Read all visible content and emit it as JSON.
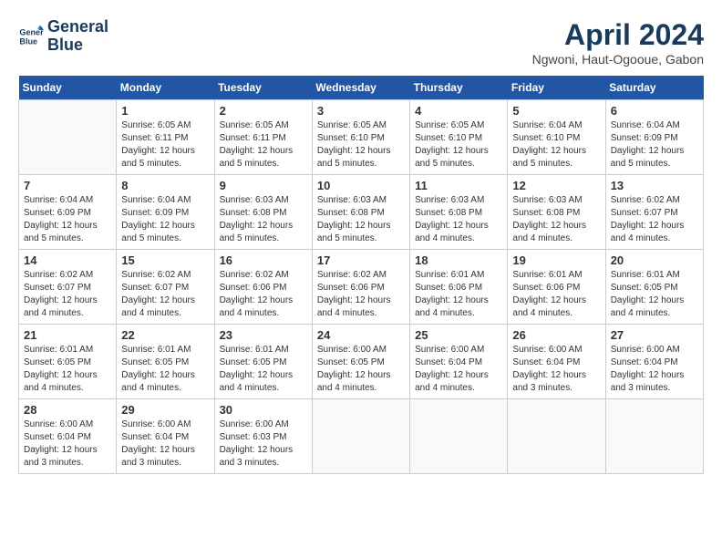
{
  "header": {
    "logo_line1": "General",
    "logo_line2": "Blue",
    "month_year": "April 2024",
    "location": "Ngwoni, Haut-Ogooue, Gabon"
  },
  "days_of_week": [
    "Sunday",
    "Monday",
    "Tuesday",
    "Wednesday",
    "Thursday",
    "Friday",
    "Saturday"
  ],
  "weeks": [
    [
      {
        "day": "",
        "sunrise": "",
        "sunset": "",
        "daylight": ""
      },
      {
        "day": "1",
        "sunrise": "Sunrise: 6:05 AM",
        "sunset": "Sunset: 6:11 PM",
        "daylight": "Daylight: 12 hours and 5 minutes."
      },
      {
        "day": "2",
        "sunrise": "Sunrise: 6:05 AM",
        "sunset": "Sunset: 6:11 PM",
        "daylight": "Daylight: 12 hours and 5 minutes."
      },
      {
        "day": "3",
        "sunrise": "Sunrise: 6:05 AM",
        "sunset": "Sunset: 6:10 PM",
        "daylight": "Daylight: 12 hours and 5 minutes."
      },
      {
        "day": "4",
        "sunrise": "Sunrise: 6:05 AM",
        "sunset": "Sunset: 6:10 PM",
        "daylight": "Daylight: 12 hours and 5 minutes."
      },
      {
        "day": "5",
        "sunrise": "Sunrise: 6:04 AM",
        "sunset": "Sunset: 6:10 PM",
        "daylight": "Daylight: 12 hours and 5 minutes."
      },
      {
        "day": "6",
        "sunrise": "Sunrise: 6:04 AM",
        "sunset": "Sunset: 6:09 PM",
        "daylight": "Daylight: 12 hours and 5 minutes."
      }
    ],
    [
      {
        "day": "7",
        "sunrise": "Sunrise: 6:04 AM",
        "sunset": "Sunset: 6:09 PM",
        "daylight": "Daylight: 12 hours and 5 minutes."
      },
      {
        "day": "8",
        "sunrise": "Sunrise: 6:04 AM",
        "sunset": "Sunset: 6:09 PM",
        "daylight": "Daylight: 12 hours and 5 minutes."
      },
      {
        "day": "9",
        "sunrise": "Sunrise: 6:03 AM",
        "sunset": "Sunset: 6:08 PM",
        "daylight": "Daylight: 12 hours and 5 minutes."
      },
      {
        "day": "10",
        "sunrise": "Sunrise: 6:03 AM",
        "sunset": "Sunset: 6:08 PM",
        "daylight": "Daylight: 12 hours and 5 minutes."
      },
      {
        "day": "11",
        "sunrise": "Sunrise: 6:03 AM",
        "sunset": "Sunset: 6:08 PM",
        "daylight": "Daylight: 12 hours and 4 minutes."
      },
      {
        "day": "12",
        "sunrise": "Sunrise: 6:03 AM",
        "sunset": "Sunset: 6:08 PM",
        "daylight": "Daylight: 12 hours and 4 minutes."
      },
      {
        "day": "13",
        "sunrise": "Sunrise: 6:02 AM",
        "sunset": "Sunset: 6:07 PM",
        "daylight": "Daylight: 12 hours and 4 minutes."
      }
    ],
    [
      {
        "day": "14",
        "sunrise": "Sunrise: 6:02 AM",
        "sunset": "Sunset: 6:07 PM",
        "daylight": "Daylight: 12 hours and 4 minutes."
      },
      {
        "day": "15",
        "sunrise": "Sunrise: 6:02 AM",
        "sunset": "Sunset: 6:07 PM",
        "daylight": "Daylight: 12 hours and 4 minutes."
      },
      {
        "day": "16",
        "sunrise": "Sunrise: 6:02 AM",
        "sunset": "Sunset: 6:06 PM",
        "daylight": "Daylight: 12 hours and 4 minutes."
      },
      {
        "day": "17",
        "sunrise": "Sunrise: 6:02 AM",
        "sunset": "Sunset: 6:06 PM",
        "daylight": "Daylight: 12 hours and 4 minutes."
      },
      {
        "day": "18",
        "sunrise": "Sunrise: 6:01 AM",
        "sunset": "Sunset: 6:06 PM",
        "daylight": "Daylight: 12 hours and 4 minutes."
      },
      {
        "day": "19",
        "sunrise": "Sunrise: 6:01 AM",
        "sunset": "Sunset: 6:06 PM",
        "daylight": "Daylight: 12 hours and 4 minutes."
      },
      {
        "day": "20",
        "sunrise": "Sunrise: 6:01 AM",
        "sunset": "Sunset: 6:05 PM",
        "daylight": "Daylight: 12 hours and 4 minutes."
      }
    ],
    [
      {
        "day": "21",
        "sunrise": "Sunrise: 6:01 AM",
        "sunset": "Sunset: 6:05 PM",
        "daylight": "Daylight: 12 hours and 4 minutes."
      },
      {
        "day": "22",
        "sunrise": "Sunrise: 6:01 AM",
        "sunset": "Sunset: 6:05 PM",
        "daylight": "Daylight: 12 hours and 4 minutes."
      },
      {
        "day": "23",
        "sunrise": "Sunrise: 6:01 AM",
        "sunset": "Sunset: 6:05 PM",
        "daylight": "Daylight: 12 hours and 4 minutes."
      },
      {
        "day": "24",
        "sunrise": "Sunrise: 6:00 AM",
        "sunset": "Sunset: 6:05 PM",
        "daylight": "Daylight: 12 hours and 4 minutes."
      },
      {
        "day": "25",
        "sunrise": "Sunrise: 6:00 AM",
        "sunset": "Sunset: 6:04 PM",
        "daylight": "Daylight: 12 hours and 4 minutes."
      },
      {
        "day": "26",
        "sunrise": "Sunrise: 6:00 AM",
        "sunset": "Sunset: 6:04 PM",
        "daylight": "Daylight: 12 hours and 3 minutes."
      },
      {
        "day": "27",
        "sunrise": "Sunrise: 6:00 AM",
        "sunset": "Sunset: 6:04 PM",
        "daylight": "Daylight: 12 hours and 3 minutes."
      }
    ],
    [
      {
        "day": "28",
        "sunrise": "Sunrise: 6:00 AM",
        "sunset": "Sunset: 6:04 PM",
        "daylight": "Daylight: 12 hours and 3 minutes."
      },
      {
        "day": "29",
        "sunrise": "Sunrise: 6:00 AM",
        "sunset": "Sunset: 6:04 PM",
        "daylight": "Daylight: 12 hours and 3 minutes."
      },
      {
        "day": "30",
        "sunrise": "Sunrise: 6:00 AM",
        "sunset": "Sunset: 6:03 PM",
        "daylight": "Daylight: 12 hours and 3 minutes."
      },
      {
        "day": "",
        "sunrise": "",
        "sunset": "",
        "daylight": ""
      },
      {
        "day": "",
        "sunrise": "",
        "sunset": "",
        "daylight": ""
      },
      {
        "day": "",
        "sunrise": "",
        "sunset": "",
        "daylight": ""
      },
      {
        "day": "",
        "sunrise": "",
        "sunset": "",
        "daylight": ""
      }
    ]
  ]
}
